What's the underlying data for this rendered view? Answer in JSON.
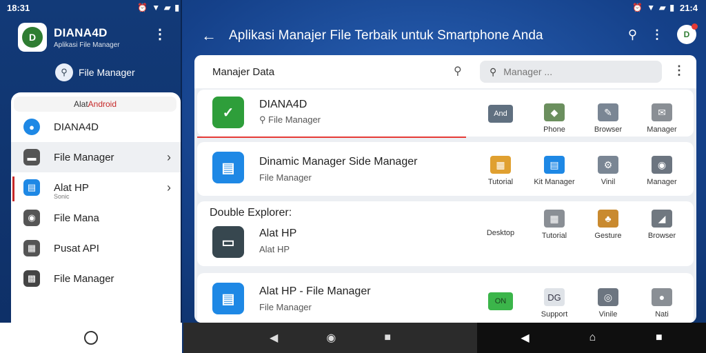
{
  "left": {
    "status": {
      "time": "18:31"
    },
    "app": {
      "title": "DIANA4D",
      "subtitle": "Aplikasi File Manager",
      "logo_letter": "D"
    },
    "account": {
      "name": "File Manager"
    },
    "drawer": {
      "header_prefix": "Alat ",
      "header_accent": "Android",
      "items": [
        {
          "label": "DIANA4D",
          "icon": "user-icon",
          "color": "#1e88e5"
        },
        {
          "label": "File Manager",
          "icon": "folder-icon",
          "color": "#555555",
          "chevron": true
        },
        {
          "label": "Alat HP",
          "icon": "file-icon",
          "color": "#1e88e5",
          "chevron": true,
          "sub": "Sonic"
        },
        {
          "label": "File Mana",
          "icon": "camera-icon",
          "color": "#555555"
        },
        {
          "label": "Pusat API",
          "icon": "grid-icon",
          "color": "#555555"
        },
        {
          "label": "File Manager",
          "icon": "clapper-icon",
          "color": "#444444"
        }
      ]
    }
  },
  "right": {
    "status": {
      "time": "21:4"
    },
    "topbar": {
      "title": "Aplikasi Manajer File Terbaik untuk Smartphone Anda"
    },
    "panel": {
      "title": "Manajer Data",
      "search": {
        "placeholder": "Manager ..."
      },
      "rows": [
        {
          "title": "DIANA4D",
          "sub": "File Manager",
          "icon_color": "#2e9e3a",
          "icon_glyph": "✓",
          "grid": [
            {
              "label": "",
              "glyph": "And",
              "color": "#607080"
            },
            {
              "label": "Phone",
              "glyph": "◆",
              "color": "#6b8f5e"
            },
            {
              "label": "Browser",
              "glyph": "✎",
              "color": "#7a8694"
            },
            {
              "label": "Manager",
              "glyph": "✉",
              "color": "#8a8f95"
            }
          ]
        },
        {
          "title": "Dinamic Manager Side Manager",
          "sub": "File Manager",
          "icon_color": "#1e88e5",
          "icon_glyph": "▤",
          "grid": [
            {
              "label": "Tutorial",
              "glyph": "▦",
              "color": "#e0a030"
            },
            {
              "label": "Kit Manager",
              "glyph": "▤",
              "color": "#1e88e5"
            },
            {
              "label": "Vinil",
              "glyph": "⚙",
              "color": "#7a8694"
            },
            {
              "label": "Manager",
              "glyph": "◉",
              "color": "#6c7580"
            }
          ]
        },
        {
          "section": "Double Explorer:",
          "title": "Alat HP",
          "sub": "Alat HP",
          "icon_color": "#37474f",
          "icon_glyph": "▭",
          "grid": [
            {
              "label": "Desktop",
              "glyph": "",
              "color": "transparent"
            },
            {
              "label": "Tutorial",
              "glyph": "▦",
              "color": "#8a8f95"
            },
            {
              "label": "Gesture",
              "glyph": "♣",
              "color": "#c98a2f"
            },
            {
              "label": "Browser",
              "glyph": "◢",
              "color": "#707880"
            }
          ]
        },
        {
          "title": "Alat HP - File Manager",
          "sub": "File Manager",
          "icon_color": "#1e88e5",
          "icon_glyph": "▤",
          "grid": [
            {
              "label": "",
              "glyph": "ON",
              "color": "#3bb54a"
            },
            {
              "label": "Support",
              "glyph": "DG",
              "color": "#dfe3e8"
            },
            {
              "label": "Vinile",
              "glyph": "◎",
              "color": "#6c7580"
            },
            {
              "label": "Nati",
              "glyph": "●",
              "color": "#8a8f95"
            }
          ]
        }
      ]
    }
  }
}
